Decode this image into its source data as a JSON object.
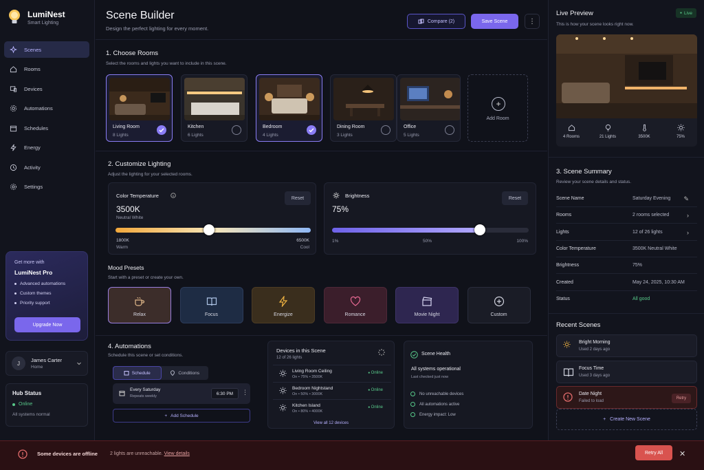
{
  "brand": {
    "name": "LumiNest",
    "tagline": "Smart Lighting"
  },
  "nav": [
    {
      "label": "Scenes",
      "icon": "sparkles-icon",
      "active": true
    },
    {
      "label": "Rooms",
      "icon": "home-icon"
    },
    {
      "label": "Devices",
      "icon": "devices-icon"
    },
    {
      "label": "Automations",
      "icon": "automation-icon"
    },
    {
      "label": "Schedules",
      "icon": "calendar-icon"
    },
    {
      "label": "Energy",
      "icon": "lightning-icon"
    },
    {
      "label": "Activity",
      "icon": "activity-icon"
    },
    {
      "label": "Settings",
      "icon": "gear-icon"
    }
  ],
  "promo": {
    "lead": "Get more with",
    "title": "LumiNest Pro",
    "features": [
      "Advanced automations",
      "Custom themes",
      "Priority support"
    ],
    "button": "Upgrade Now"
  },
  "user": {
    "initial": "J",
    "name": "James Carter",
    "role": "Home"
  },
  "hub": {
    "title": "Hub Status",
    "status": "Online",
    "detail": "All systems normal"
  },
  "header": {
    "title": "Scene Builder",
    "subtitle": "Design the perfect lighting for every moment.",
    "compare": "Compare (2)",
    "save": "Save Scene"
  },
  "rooms_section": {
    "title": "1. Choose Rooms",
    "subtitle": "Select the rooms and lights you want to include in this scene.",
    "add": "Add Room",
    "rooms": [
      {
        "name": "Living Room",
        "lights": "8 Lights",
        "selected": true
      },
      {
        "name": "Kitchen",
        "lights": "6 Lights",
        "selected": false
      },
      {
        "name": "Bedroom",
        "lights": "4 Lights",
        "selected": true
      },
      {
        "name": "Dining Room",
        "lights": "3 Lights",
        "selected": false
      },
      {
        "name": "Office",
        "lights": "5 Lights",
        "selected": false
      }
    ]
  },
  "lighting": {
    "title": "2. Customize Lighting",
    "subtitle": "Adjust the lighting for your selected rooms.",
    "temp": {
      "label": "Color Temperature",
      "value": "3500K",
      "desc": "Neutral White",
      "reset": "Reset",
      "min": "1800K",
      "min_desc": "Warm",
      "max": "6500K",
      "max_desc": "Cool",
      "level": 0.5
    },
    "bright": {
      "label": "Brightness",
      "value": "75%",
      "reset": "Reset",
      "t0": "1%",
      "t1": "50%",
      "t2": "100%",
      "level": 0.75
    }
  },
  "moods": {
    "title": "Mood Presets",
    "subtitle": "Start with a preset or create your own.",
    "items": [
      {
        "label": "Relax",
        "icon": "coffee-icon",
        "bg": "#3c2d2a",
        "border": "#9a7fe0",
        "color": "#e2b98a"
      },
      {
        "label": "Focus",
        "icon": "book-icon",
        "bg": "#1e2c44",
        "border": "#2c3c5a",
        "color": "#aec4e6"
      },
      {
        "label": "Energize",
        "icon": "lightning-icon",
        "bg": "#3a2e1d",
        "border": "#4c3c24",
        "color": "#f0b341"
      },
      {
        "label": "Romance",
        "icon": "heart-icon",
        "bg": "#3b1e2b",
        "border": "#4d2838",
        "color": "#e86a94"
      },
      {
        "label": "Movie Night",
        "icon": "clapper-icon",
        "bg": "#2e2650",
        "border": "#3e3468",
        "color": "#d9d6f2"
      },
      {
        "label": "Custom",
        "icon": "plus-circle-icon",
        "bg": "#1a1c26",
        "border": "#2a2d3c",
        "color": "#d0d2dd"
      }
    ]
  },
  "automations": {
    "title": "4. Automations",
    "subtitle": "Schedule this scene or set conditions.",
    "tab1": "Schedule",
    "tab2": "Conditions",
    "sched_title": "Every Saturday",
    "sched_desc": "Repeats weekly",
    "time": "6:30 PM",
    "add": "Add Schedule"
  },
  "devices": {
    "title": "Devices in this Scene",
    "count": "12 of 26 lights",
    "view_all": "View all 12 devices",
    "items": [
      {
        "name": "Living Room Ceiling",
        "detail": "On  •  75%  •  3500K",
        "status": "Online"
      },
      {
        "name": "Bedroom Nightstand",
        "detail": "On  •  50%  •  3000K",
        "status": "Online"
      },
      {
        "name": "Kitchen Island",
        "detail": "On  •  80%  •  4000K",
        "status": "Online"
      }
    ]
  },
  "health": {
    "title": "Scene Health",
    "status": "All systems operational",
    "checked": "Last checked just now",
    "items": [
      "No unreachable devices",
      "All automations active",
      "Energy impact: Low"
    ]
  },
  "preview": {
    "title": "Live Preview",
    "badge": "Live",
    "subtitle": "This is how your scene looks right now.",
    "stats": [
      {
        "icon": "home-icon",
        "label": "4 Rooms"
      },
      {
        "icon": "bulb-icon",
        "label": "21 Lights"
      },
      {
        "icon": "thermometer-icon",
        "label": "3500K"
      },
      {
        "icon": "sun-icon",
        "label": "75%"
      }
    ]
  },
  "summary": {
    "title": "3. Scene Summary",
    "subtitle": "Review your scene details and status.",
    "rows": [
      {
        "k": "Scene Name",
        "v": "Saturday Evening",
        "ic": "✎"
      },
      {
        "k": "Rooms",
        "v": "2 rooms selected",
        "ic": "›"
      },
      {
        "k": "Lights",
        "v": "12 of 26 lights",
        "ic": "›"
      },
      {
        "k": "Color Temperature",
        "v": "3500K Neutral White",
        "ic": ""
      },
      {
        "k": "Brightness",
        "v": "75%",
        "ic": ""
      },
      {
        "k": "Created",
        "v": "May 24, 2025, 10:30 AM",
        "ic": ""
      },
      {
        "k": "Status",
        "v": "All good",
        "ic": ""
      }
    ]
  },
  "recent": {
    "title": "Recent Scenes",
    "new": "Create New Scene",
    "retry": "Retry",
    "items": [
      {
        "name": "Bright Morning",
        "when": "Used 2 days ago",
        "icon": "sun-icon"
      },
      {
        "name": "Focus Time",
        "when": "Used 3 days ago",
        "icon": "book-icon"
      },
      {
        "name": "Date Night",
        "when": "Failed to load",
        "icon": "alert-icon"
      }
    ]
  },
  "banner": {
    "title": "Some devices are offline",
    "detail": "2 lights are unreachable.",
    "link": "View details",
    "retry": "Retry All"
  },
  "colors": {
    "accent": "#7a67ec",
    "success": "#58c98a",
    "danger": "#d9534f"
  }
}
